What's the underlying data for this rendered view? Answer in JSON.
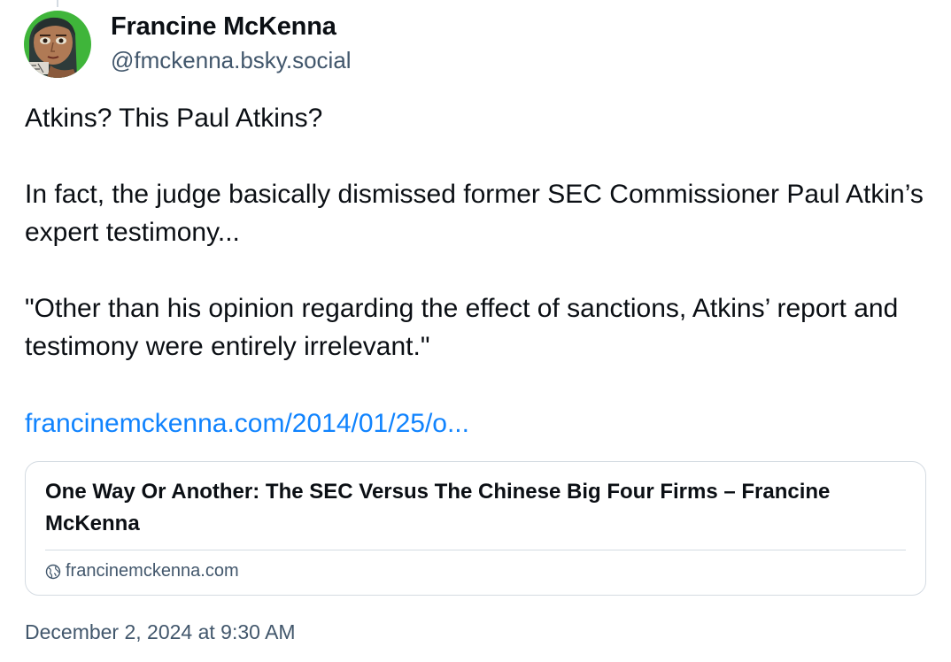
{
  "author": {
    "name": "Francine McKenna",
    "handle": "@fmckenna.bsky.social",
    "avatar_icon": "avatar-illustrated-face"
  },
  "post": {
    "paragraphs": [
      "Atkins?  This Paul Atkins?",
      "In fact, the judge basically dismissed former SEC Commissioner Paul Atkin’s expert testimony...",
      "\"Other than his opinion regarding the effect of sanctions, Atkins’ report and testimony were entirely irrelevant.\""
    ],
    "link_text": "francinemckenna.com/2014/01/25/o..."
  },
  "link_card": {
    "title": "One Way Or Another: The SEC Versus The Chinese Big Four Firms  – Francine McKenna",
    "domain": "francinemckenna.com",
    "domain_icon": "globe-icon"
  },
  "timestamp": "December 2, 2024 at 9:30 AM",
  "colors": {
    "link": "#1083fe",
    "muted": "#42576c",
    "border": "#d4dbe2",
    "text": "#0b0f14",
    "avatar_bg": "#3fb53a"
  }
}
